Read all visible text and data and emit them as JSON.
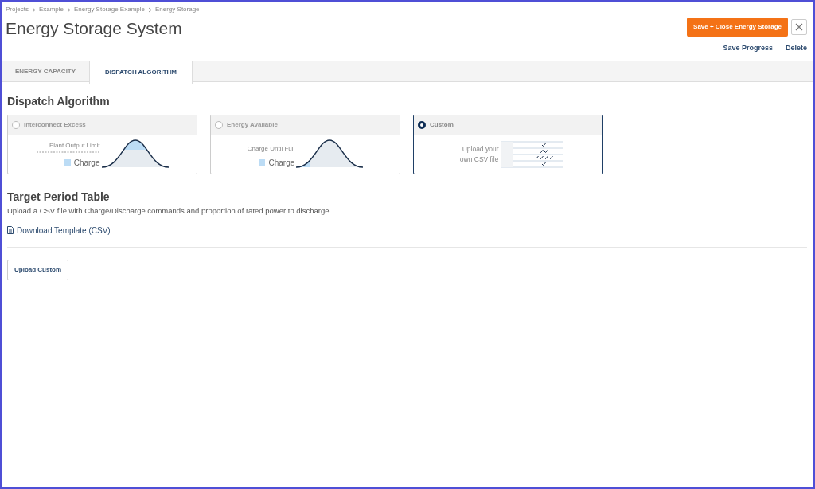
{
  "breadcrumbs": [
    "Projects",
    "Example",
    "Energy Storage Example",
    "Energy Storage"
  ],
  "title": "Energy Storage System",
  "actions": {
    "primary": "Save + Close Energy Storage",
    "links": [
      "Save Progress",
      "Delete"
    ]
  },
  "tabs": [
    {
      "label": "ENERGY CAPACITY",
      "selected": false
    },
    {
      "label": "DISPATCH ALGORITHM",
      "selected": true
    }
  ],
  "section_title": "Dispatch Algorithm",
  "options": [
    {
      "kind": "limit",
      "label": "Interconnect Excess",
      "selected": false,
      "caption": "Plant Output Limit",
      "legend": "Charge"
    },
    {
      "kind": "until_full",
      "label": "Energy Available",
      "selected": false,
      "caption": "Charge Until Full",
      "legend": "Charge"
    },
    {
      "kind": "custom",
      "label": "Custom",
      "selected": true,
      "caption": "Upload your own CSV file"
    }
  ],
  "target": {
    "title": "Target Period Table",
    "description": "Upload a CSV file with Charge/Discharge commands and proportion of rated power to discharge.",
    "download_link": "Download Template (CSV)",
    "upload_button": "Upload Custom"
  }
}
